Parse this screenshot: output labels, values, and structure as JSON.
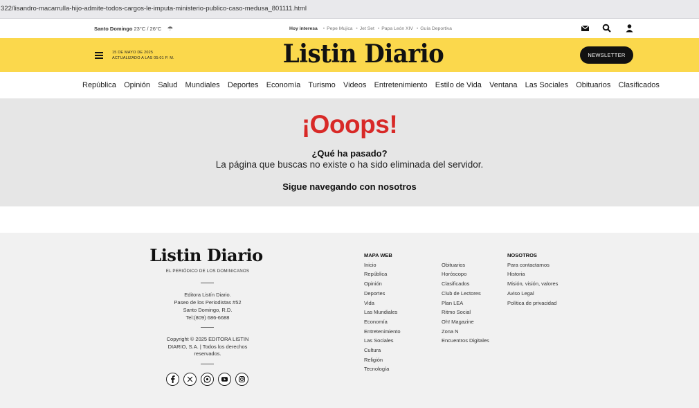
{
  "browser": {
    "url": "322/lisandro-macarrulla-hijo-admite-todos-cargos-le-imputa-ministerio-publico-caso-medusa_801111.html"
  },
  "topbar": {
    "city": "Santo Domingo",
    "temps": "23°C / 26°C",
    "interest_lead": "Hoy interesa",
    "interest_items": [
      "Pepe Mujica",
      "Jet Set",
      "Papa León XIV",
      "Guía Deportiva"
    ],
    "icons": [
      "mail-icon",
      "search-icon",
      "user-icon"
    ]
  },
  "header": {
    "date": "15 DE MAYO DE 2025",
    "updated": "ACTUALIZADO A LAS 05:01 P. M.",
    "logo": "Listin Diario",
    "newsletter_label": "NEWSLETTER",
    "brand_color": "#fbd84c"
  },
  "nav": {
    "items": [
      "República",
      "Opinión",
      "Salud",
      "Mundiales",
      "Deportes",
      "Economía",
      "Turismo",
      "Videos",
      "Entretenimiento",
      "Estilo de Vida",
      "Ventana",
      "Las Sociales",
      "Obituarios",
      "Clasificados"
    ]
  },
  "error": {
    "title": "¡Ooops!",
    "question": "¿Qué ha pasado?",
    "message": "La página que buscas no existe o ha sido eliminada del servidor.",
    "continue": "Sigue navegando con nosotros",
    "accent_color": "#d82927"
  },
  "footer": {
    "logo": "Listin Diario",
    "tagline": "EL PERIÓDICO DE LOS DOMINICANOS",
    "address": [
      "Editora Listín Diario.",
      "Paseo de los Periodistas #52",
      "Santo Domingo, R.D.",
      "Tel:(809) 686-6688"
    ],
    "copyright": "Copyright © 2025 EDITORA LISTIN DIARIO, S.A. | Todos los derechos reservados.",
    "social": [
      "facebook-icon",
      "x-icon",
      "whatsapp-icon",
      "youtube-icon",
      "instagram-icon"
    ],
    "sitemap_title": "MAPA WEB",
    "sitemap_col1": [
      "Inicio",
      "República",
      "Opinión",
      "Deportes",
      "Vida",
      "Las Mundiales",
      "Economía",
      "Entretenimiento",
      "Las Sociales",
      "Cultura",
      "Religión",
      "Tecnología"
    ],
    "sitemap_col2": [
      "Obituarios",
      "Horóscopo",
      "Clasificados",
      "Club de Lectores",
      "Plan LEA",
      "Ritmo Social",
      "Oh! Magazine",
      "Zona N",
      "Encuentros Digitales"
    ],
    "about_title": "NOSOTROS",
    "about_items": [
      "Para contactarnos",
      "Historia",
      "Misión, visión, valores",
      "Aviso Legal",
      "Política de privacidad"
    ]
  }
}
